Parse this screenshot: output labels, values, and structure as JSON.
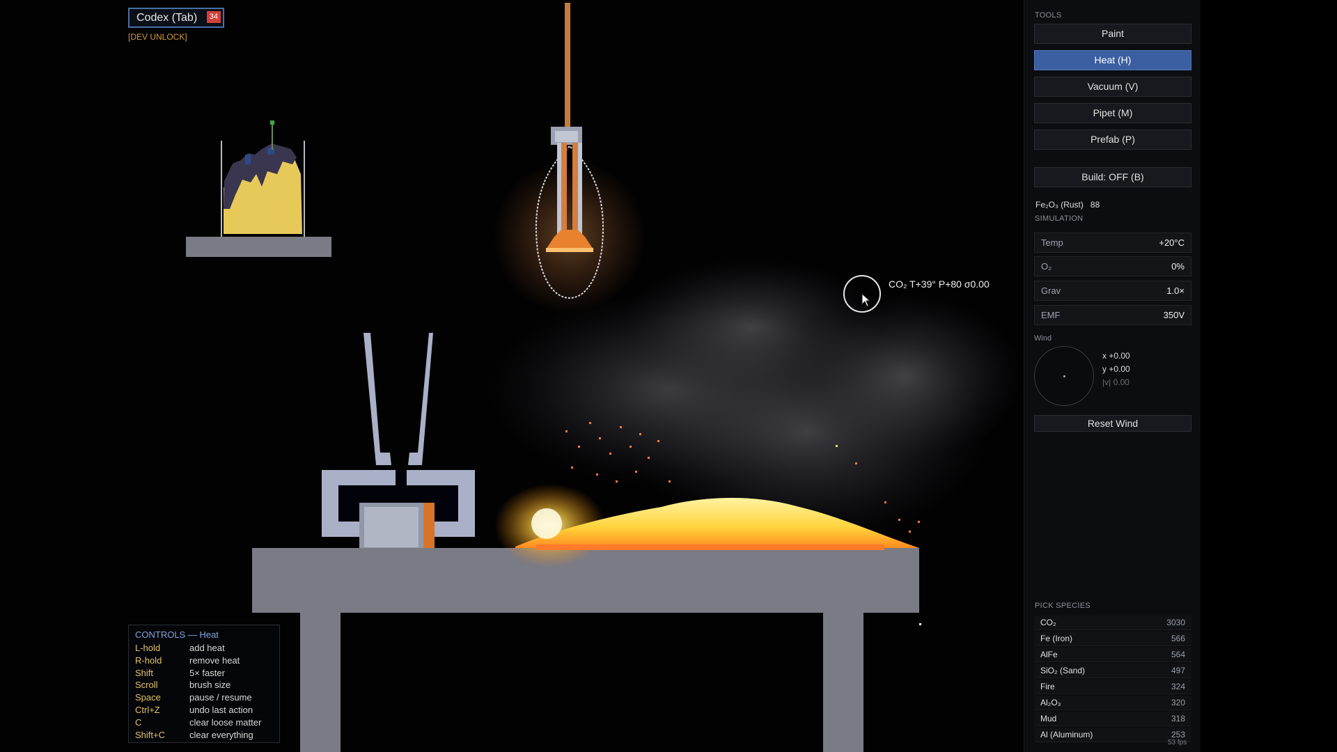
{
  "codex": {
    "label": "Codex (Tab)",
    "badge": "34",
    "dev_unlock": "[DEV UNLOCK]"
  },
  "probe": {
    "species": "CO₂",
    "readout": "T+39° P+80 σ0.00"
  },
  "controls": {
    "title": "CONTROLS — Heat",
    "rows": [
      {
        "key": "L-hold",
        "action": "add heat"
      },
      {
        "key": "R-hold",
        "action": "remove heat"
      },
      {
        "key": "Shift",
        "action": "5× faster"
      },
      {
        "key": "Scroll",
        "action": "brush size"
      },
      {
        "key": "Space",
        "action": "pause / resume"
      },
      {
        "key": "Ctrl+Z",
        "action": "undo last action"
      },
      {
        "key": "C",
        "action": "clear loose matter"
      },
      {
        "key": "Shift+C",
        "action": "clear everything"
      }
    ]
  },
  "panel": {
    "tools_label": "TOOLS",
    "tools": [
      "Paint",
      "Heat (H)",
      "Vacuum (V)",
      "Pipet (M)",
      "Prefab (P)"
    ],
    "active_tool": "Heat (H)",
    "build": "Build: OFF (B)",
    "selected": {
      "name": "Fe₂O₃ (Rust)",
      "count": "88"
    },
    "simulation_label": "SIMULATION",
    "sim": [
      {
        "label": "Temp",
        "value": "+20°C"
      },
      {
        "label": "O₂",
        "value": "0%"
      },
      {
        "label": "Grav",
        "value": "1.0×"
      },
      {
        "label": "EMF",
        "value": "350V"
      }
    ],
    "wind": {
      "label": "Wind",
      "x": "x +0.00",
      "y": "y +0.00",
      "mag": "|v| 0.00"
    },
    "reset_wind": "Reset Wind",
    "pick_label": "PICK SPECIES",
    "species": [
      {
        "name": "CO₂",
        "count": "3030"
      },
      {
        "name": "Fe (Iron)",
        "count": "566"
      },
      {
        "name": "AlFe",
        "count": "564"
      },
      {
        "name": "SiO₂ (Sand)",
        "count": "497"
      },
      {
        "name": "Fire",
        "count": "324"
      },
      {
        "name": "Al₂O₃",
        "count": "320"
      },
      {
        "name": "Mud",
        "count": "318"
      },
      {
        "name": "Al (Aluminum)",
        "count": "253"
      }
    ],
    "fps": "53 fps"
  },
  "colors": {
    "accent": "#3b5fa0",
    "key_text": "#e3c466",
    "badge": "#d0403a",
    "stone": "#7b7b85"
  }
}
